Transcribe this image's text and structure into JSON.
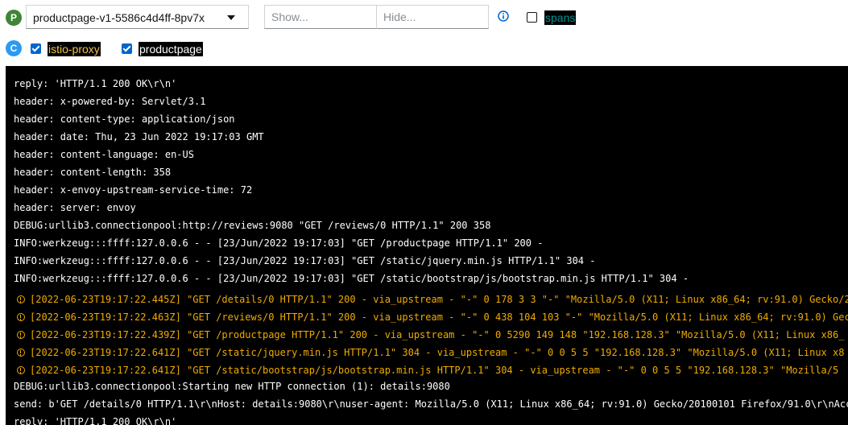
{
  "toolbar": {
    "pod_badge": "P",
    "pod_select_value": "productpage-v1-5586c4d4ff-8pv7x",
    "show_placeholder": "Show...",
    "hide_placeholder": "Hide...",
    "spans_label": "spans",
    "spans_checked": false
  },
  "containers": {
    "badge": "C",
    "items": [
      {
        "label": "istio-proxy",
        "checked": true,
        "color": "#f4c145"
      },
      {
        "label": "productpage",
        "checked": true,
        "color": "#ffffff"
      }
    ]
  },
  "log": {
    "lines": [
      {
        "text": "reply: 'HTTP/1.1 200 OK\\r\\n'",
        "source": "productpage"
      },
      {
        "text": "header: x-powered-by: Servlet/3.1",
        "source": "productpage"
      },
      {
        "text": "header: content-type: application/json",
        "source": "productpage"
      },
      {
        "text": "header: date: Thu, 23 Jun 2022 19:17:03 GMT",
        "source": "productpage"
      },
      {
        "text": "header: content-language: en-US",
        "source": "productpage"
      },
      {
        "text": "header: content-length: 358",
        "source": "productpage"
      },
      {
        "text": "header: x-envoy-upstream-service-time: 72",
        "source": "productpage"
      },
      {
        "text": "header: server: envoy",
        "source": "productpage"
      },
      {
        "text": "DEBUG:urllib3.connectionpool:http://reviews:9080 \"GET /reviews/0 HTTP/1.1\" 200 358",
        "source": "productpage"
      },
      {
        "text": "INFO:werkzeug:::ffff:127.0.0.6 - - [23/Jun/2022 19:17:03] \"GET /productpage HTTP/1.1\" 200 -",
        "source": "productpage"
      },
      {
        "text": "INFO:werkzeug:::ffff:127.0.0.6 - - [23/Jun/2022 19:17:03] \"GET /static/jquery.min.js HTTP/1.1\" 304 -",
        "source": "productpage"
      },
      {
        "text": "INFO:werkzeug:::ffff:127.0.0.6 - - [23/Jun/2022 19:17:03] \"GET /static/bootstrap/js/bootstrap.min.js HTTP/1.1\" 304 -",
        "source": "productpage"
      },
      {
        "text": "[2022-06-23T19:17:22.445Z] \"GET /details/0 HTTP/1.1\" 200 - via_upstream - \"-\" 0 178 3 3 \"-\" \"Mozilla/5.0 (X11; Linux x86_64; rv:91.0) Gecko/2",
        "source": "istio-proxy"
      },
      {
        "text": "[2022-06-23T19:17:22.463Z] \"GET /reviews/0 HTTP/1.1\" 200 - via_upstream - \"-\" 0 438 104 103 \"-\" \"Mozilla/5.0 (X11; Linux x86_64; rv:91.0) Gec",
        "source": "istio-proxy"
      },
      {
        "text": "[2022-06-23T19:17:22.439Z] \"GET /productpage HTTP/1.1\" 200 - via_upstream - \"-\" 0 5290 149 148 \"192.168.128.3\" \"Mozilla/5.0 (X11; Linux x86_",
        "source": "istio-proxy"
      },
      {
        "text": "[2022-06-23T19:17:22.641Z] \"GET /static/jquery.min.js HTTP/1.1\" 304 - via_upstream - \"-\" 0 0 5 5 \"192.168.128.3\" \"Mozilla/5.0 (X11; Linux x8",
        "source": "istio-proxy"
      },
      {
        "text": "[2022-06-23T19:17:22.641Z] \"GET /static/bootstrap/js/bootstrap.min.js HTTP/1.1\" 304 - via_upstream - \"-\" 0 0 5 5 \"192.168.128.3\" \"Mozilla/5",
        "source": "istio-proxy"
      },
      {
        "text": "DEBUG:urllib3.connectionpool:Starting new HTTP connection (1): details:9080",
        "source": "productpage"
      },
      {
        "text": "send: b'GET /details/0 HTTP/1.1\\r\\nHost: details:9080\\r\\nuser-agent: Mozilla/5.0 (X11; Linux x86_64; rv:91.0) Gecko/20100101 Firefox/91.0\\r\\nAcc",
        "source": "productpage"
      },
      {
        "text": "reply: 'HTTP/1.1 200 OK\\r\\n'",
        "source": "productpage"
      }
    ]
  }
}
